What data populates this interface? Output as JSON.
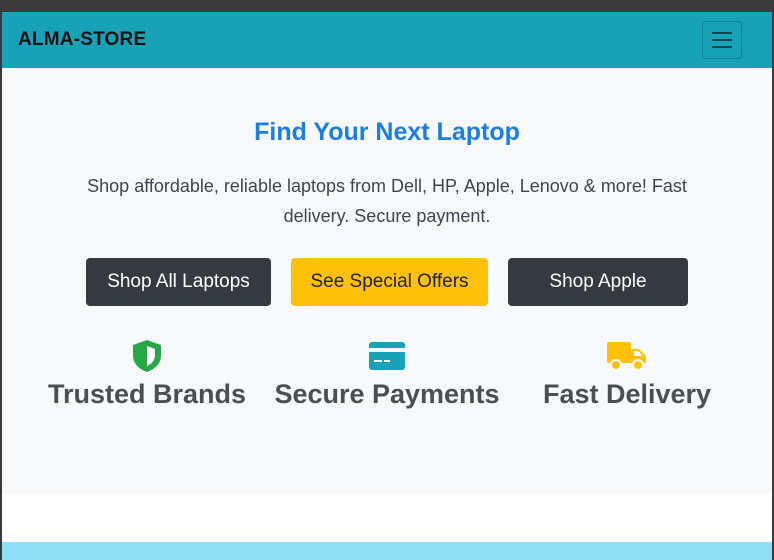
{
  "navbar": {
    "brand": "ALMA-STORE",
    "menu_icon": "hamburger-menu-icon",
    "bg": "#17a2b8"
  },
  "hero": {
    "title": "Find Your Next Laptop",
    "subtitle": "Shop affordable, reliable laptops from Dell, HP, Apple, Lenovo & more! Fast delivery. Secure payment.",
    "title_color": "#1a7ee6"
  },
  "buttons": {
    "shop_all": "Shop All Laptops",
    "special_offers": "See Special Offers",
    "shop_apple": "Shop Apple"
  },
  "features": [
    {
      "icon": "shield-icon",
      "label": "Trusted Brands",
      "color": "#28a745"
    },
    {
      "icon": "credit-card-icon",
      "label": "Secure Payments",
      "color": "#17a2b8"
    },
    {
      "icon": "truck-icon",
      "label": "Fast Delivery",
      "color": "#ffc107"
    }
  ]
}
